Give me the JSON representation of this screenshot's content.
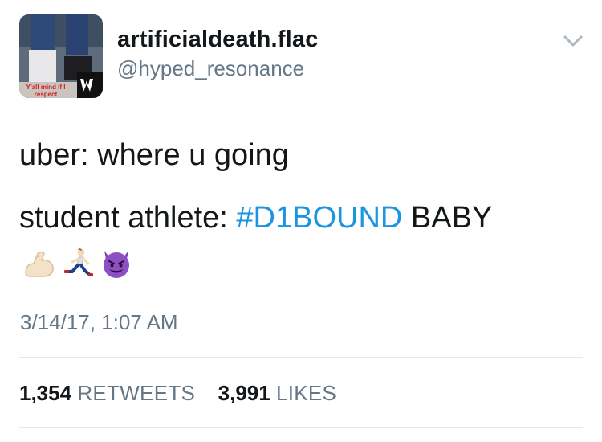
{
  "user": {
    "display_name": "artificialdeath.flac",
    "handle": "@hyped_resonance",
    "avatar_caption": "Y'all mind if I respect women?"
  },
  "tweet": {
    "line1": "uber: where u going",
    "line2_prefix": "student athlete: ",
    "hashtag": "#D1BOUND",
    "line2_suffix": " BABY",
    "emojis": [
      "flexed-biceps-icon",
      "person-running-icon",
      "smiling-imp-icon"
    ],
    "timestamp": "3/14/17, 1:07 AM"
  },
  "stats": {
    "retweets_count": "1,354",
    "retweets_label": "RETWEETS",
    "likes_count": "3,991",
    "likes_label": "LIKES"
  },
  "colors": {
    "text": "#14171a",
    "muted": "#657786",
    "link": "#1b95e0",
    "divider": "#e1e8ed"
  }
}
